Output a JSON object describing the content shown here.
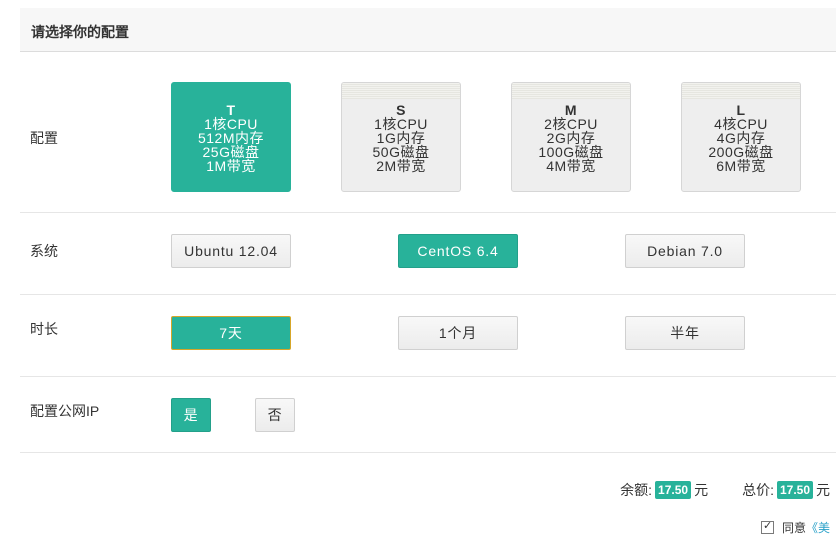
{
  "header": {
    "title": "请选择你的配置"
  },
  "config": {
    "label": "配置",
    "plans": [
      {
        "name": "T",
        "cpu": "1核CPU",
        "ram": "512M内存",
        "disk": "25G磁盘",
        "bw": "1M带宽",
        "selected": true
      },
      {
        "name": "S",
        "cpu": "1核CPU",
        "ram": "1G内存",
        "disk": "50G磁盘",
        "bw": "2M带宽",
        "selected": false
      },
      {
        "name": "M",
        "cpu": "2核CPU",
        "ram": "2G内存",
        "disk": "100G磁盘",
        "bw": "4M带宽",
        "selected": false
      },
      {
        "name": "L",
        "cpu": "4核CPU",
        "ram": "4G内存",
        "disk": "200G磁盘",
        "bw": "6M带宽",
        "selected": false
      }
    ]
  },
  "os": {
    "label": "系统",
    "options": [
      "Ubuntu 12.04",
      "CentOS 6.4",
      "Debian 7.0"
    ],
    "selected": "CentOS 6.4"
  },
  "duration": {
    "label": "时长",
    "options": [
      "7天",
      "1个月",
      "半年"
    ],
    "selected": "7天"
  },
  "public_ip": {
    "label": "配置公网IP",
    "options": [
      "是",
      "否"
    ],
    "selected": "是"
  },
  "summary": {
    "balance_label": "余额:",
    "balance_value": "17.50",
    "balance_unit": "元",
    "total_label": "总价:",
    "total_value": "17.50",
    "total_unit": "元"
  },
  "agreement": {
    "checked": true,
    "text": "同意",
    "link_text": "《美"
  },
  "colors": {
    "accent": "#28b29a",
    "selected_outline": "#d6a629",
    "link": "#28a0c8"
  }
}
